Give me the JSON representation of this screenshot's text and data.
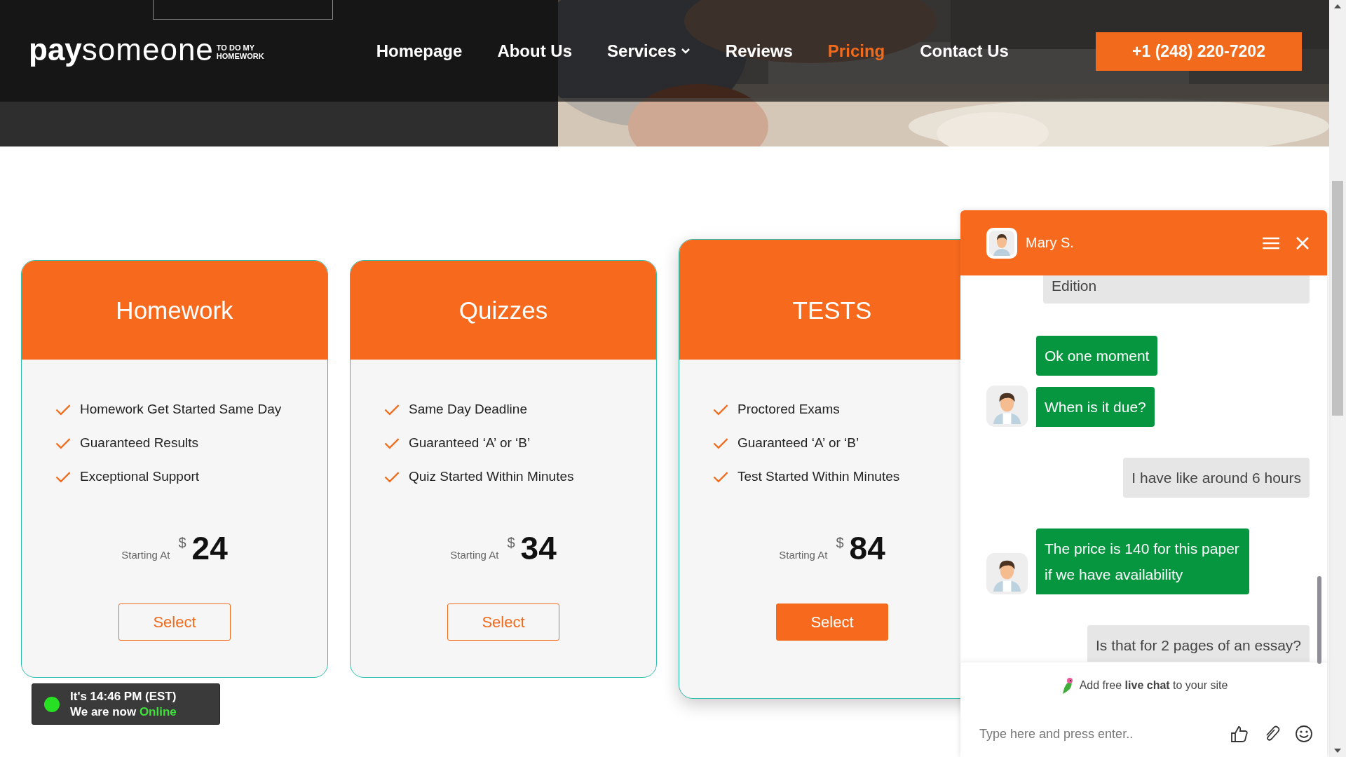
{
  "header": {
    "logo": {
      "primary": "pay",
      "secondary": "someone",
      "tagline_1": "TO DO MY",
      "tagline_2": "HOMEWORK"
    },
    "nav": [
      {
        "label": "Homepage",
        "selected": false,
        "has_dropdown": false
      },
      {
        "label": "About Us",
        "selected": false,
        "has_dropdown": false
      },
      {
        "label": "Services",
        "selected": false,
        "has_dropdown": true
      },
      {
        "label": "Reviews",
        "selected": false,
        "has_dropdown": false
      },
      {
        "label": "Pricing",
        "selected": true,
        "has_dropdown": false
      },
      {
        "label": "Contact Us",
        "selected": false,
        "has_dropdown": false
      }
    ],
    "phone_button": "+1 (248) 220-7202"
  },
  "plans": [
    {
      "title": "Homework",
      "features": [
        "Homework Get Started Same Day",
        "Guaranteed Results",
        "Exceptional Support"
      ],
      "starting_label": "Starting At",
      "currency": "$",
      "price": "24",
      "button": "Select",
      "featured": false
    },
    {
      "title": "Quizzes",
      "features": [
        "Same Day Deadline",
        "Guaranteed ‘A’ or ‘B’",
        "Quiz Started Within Minutes"
      ],
      "starting_label": "Starting At",
      "currency": "$",
      "price": "34",
      "button": "Select",
      "featured": false
    },
    {
      "title": "TESTS",
      "features": [
        "Proctored Exams",
        "Guaranteed ‘A’ or ‘B’",
        "Test Started Within Minutes"
      ],
      "starting_label": "Starting At",
      "currency": "$",
      "price": "84",
      "button": "Select",
      "featured": true
    }
  ],
  "status_badge": {
    "line_1": "It's 14:46 PM (EST)",
    "line_2": "We are now",
    "status": "Online"
  },
  "chat": {
    "agent_name": "Mary S.",
    "messages": [
      {
        "kind": "visitor",
        "text": "Edition"
      },
      {
        "kind": "agent",
        "text": "Ok one moment",
        "show_avatar": false
      },
      {
        "kind": "agent",
        "text": "When is it due?",
        "show_avatar": true
      },
      {
        "kind": "visitor",
        "text": "I have like around 6 hours"
      },
      {
        "kind": "agent",
        "text": "The price is 140 for this paper if we have availability",
        "show_avatar": true
      },
      {
        "kind": "visitor",
        "text": "Is that for 2 pages of an essay?"
      }
    ],
    "promo": "Add free **live chat** to your site",
    "input": {
      "placeholder": "Type here and press enter.."
    }
  }
}
